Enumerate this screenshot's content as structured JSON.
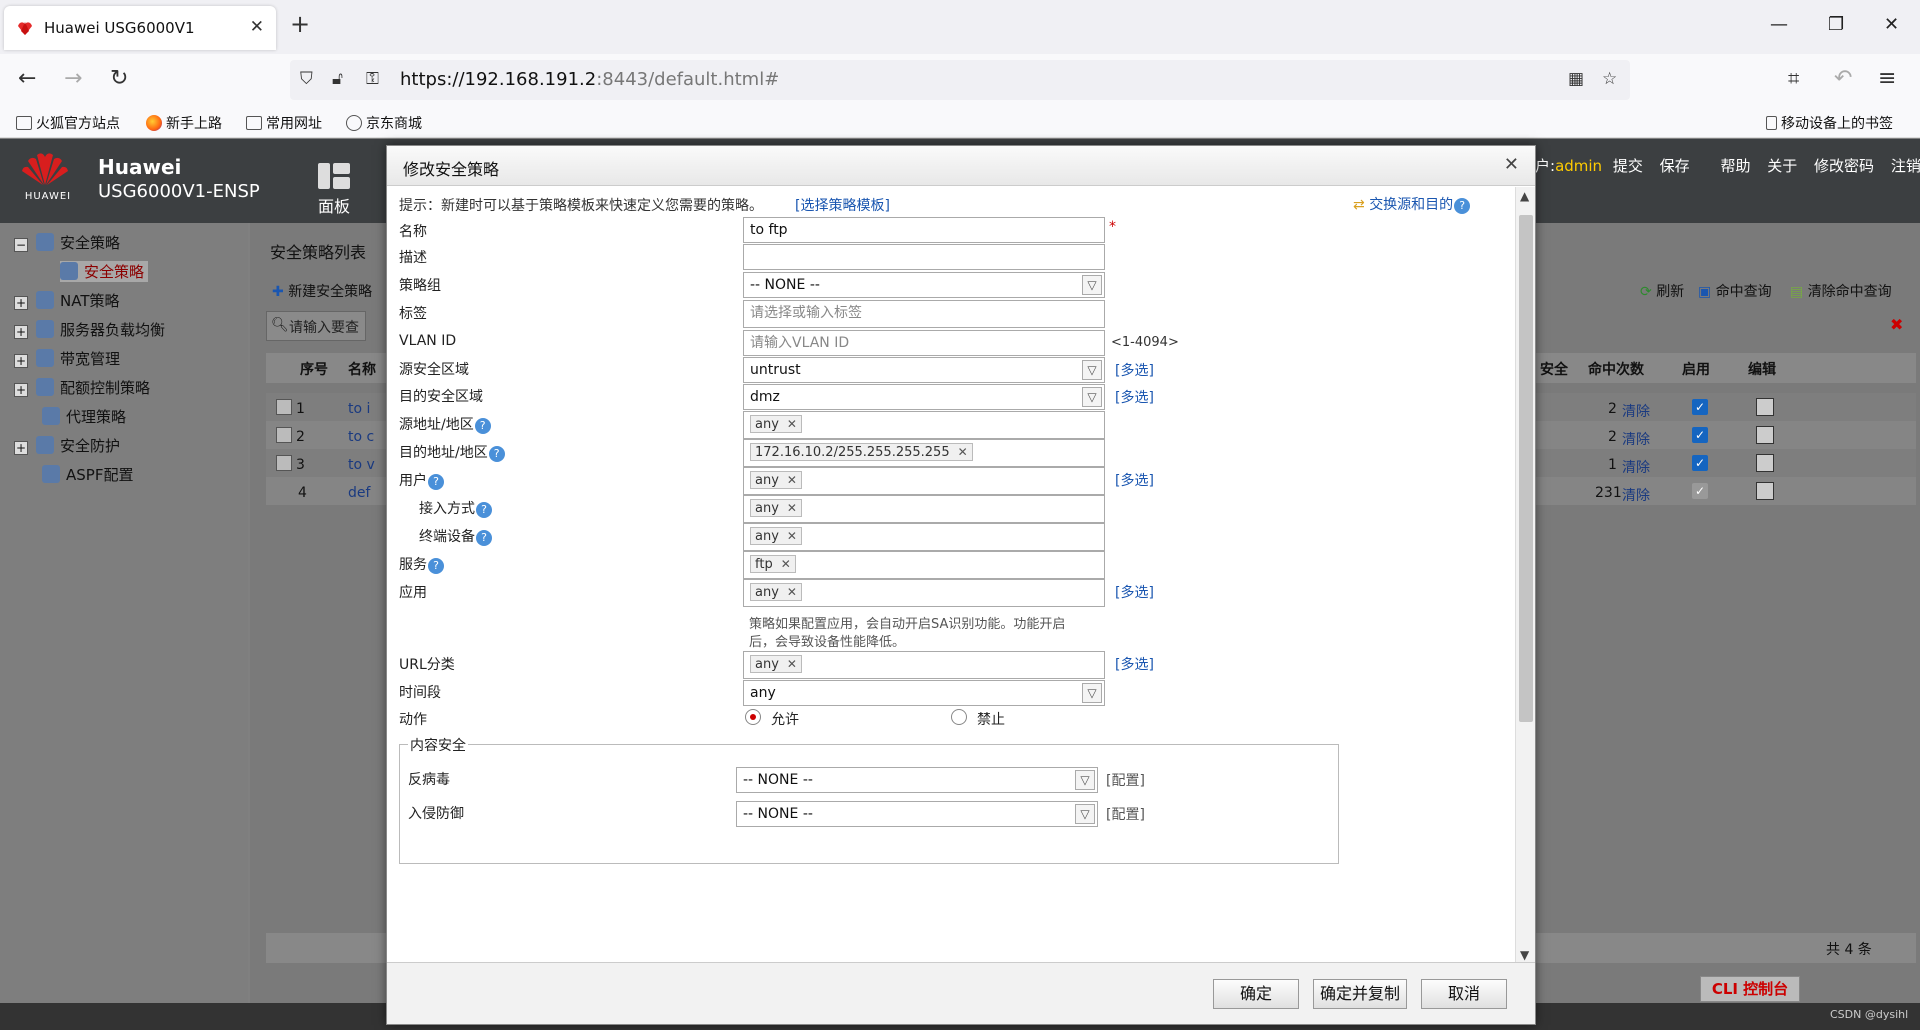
{
  "browser": {
    "tab_title": "Huawei USG6000V1",
    "url_host": "https://192.168.191.2",
    "url_rest": ":8443/default.html#",
    "bookmarks": [
      "火狐官方站点",
      "新手上路",
      "常用网址",
      "京东商城"
    ],
    "mobile_bookmarks": "移动设备上的书签"
  },
  "app": {
    "logo_text": "HUAWEI",
    "brand_name": "Huawei",
    "device_name": "USG6000V1-ENSP",
    "panel_label": "面板",
    "user_prefix": "户:",
    "user": "admin",
    "menu": [
      "提交",
      "保存",
      "帮助",
      "关于",
      "修改密码",
      "注销"
    ]
  },
  "sidebar": {
    "items": [
      {
        "label": "安全策略",
        "expand": "−"
      },
      {
        "label": "安全策略"
      },
      {
        "label": "NAT策略",
        "expand": "+"
      },
      {
        "label": "服务器负载均衡",
        "expand": "+"
      },
      {
        "label": "带宽管理",
        "expand": "+"
      },
      {
        "label": "配额控制策略",
        "expand": "+"
      },
      {
        "label": "代理策略"
      },
      {
        "label": "安全防护",
        "expand": "+"
      },
      {
        "label": "ASPF配置"
      }
    ]
  },
  "main": {
    "title": "安全策略列表",
    "new_button": "新建安全策略",
    "search_placeholder": "请输入要查",
    "refresh": "刷新",
    "hit_query": "命中查询",
    "clear_hit": "清除命中查询",
    "columns": {
      "index": "序号",
      "name": "名称",
      "security": "安全",
      "hits": "命中次数",
      "enable": "启用",
      "edit": "编辑"
    },
    "rows": [
      {
        "index": "1",
        "name": "to i",
        "hits": "2",
        "clear": "清除"
      },
      {
        "index": "2",
        "name": "to c",
        "hits": "2",
        "clear": "清除"
      },
      {
        "index": "3",
        "name": "to v",
        "hits": "1",
        "clear": "清除"
      },
      {
        "index": "4",
        "name": "def",
        "hits": "231",
        "clear": "清除"
      }
    ],
    "total": "共 4 条",
    "cli": "CLI 控制台",
    "watermark": "CSDN @dysihl"
  },
  "dialog": {
    "title": "修改安全策略",
    "hint_prefix": "提示：新建时可以基于策略模板来快速定义您需要的策略。",
    "hint_link": "[选择策略模板]",
    "swap": "交换源和目的",
    "fields": {
      "name_label": "名称",
      "name_value": "to ftp",
      "desc_label": "描述",
      "group_label": "策略组",
      "group_value": "-- NONE --",
      "tag_label": "标签",
      "tag_placeholder": "请选择或输入标签",
      "vlan_label": "VLAN ID",
      "vlan_placeholder": "请输入VLAN ID",
      "vlan_range": "<1-4094>",
      "src_zone_label": "源安全区域",
      "src_zone_value": "untrust",
      "dst_zone_label": "目的安全区域",
      "dst_zone_value": "dmz",
      "src_addr_label": "源地址/地区",
      "src_addr_value": "any",
      "dst_addr_label": "目的地址/地区",
      "dst_addr_value": "172.16.10.2/255.255.255.255",
      "user_label": "用户",
      "user_value": "any",
      "access_label": "接入方式",
      "access_value": "any",
      "terminal_label": "终端设备",
      "terminal_value": "any",
      "service_label": "服务",
      "service_value": "ftp",
      "app_label": "应用",
      "app_value": "any",
      "app_note_1": "策略如果配置应用，会自动开启SA识别功能。功能开启",
      "app_note_2": "后，会导致设备性能降低。",
      "url_label": "URL分类",
      "url_value": "any",
      "time_label": "时间段",
      "time_value": "any",
      "action_label": "动作",
      "allow": "允许",
      "deny": "禁止",
      "multi": "[多选]"
    },
    "content_security": {
      "legend": "内容安全",
      "antivirus_label": "反病毒",
      "antivirus_value": "-- NONE --",
      "ips_label": "入侵防御",
      "ips_value": "-- NONE --",
      "configure": "[配置]"
    },
    "buttons": {
      "ok": "确定",
      "ok_copy": "确定并复制",
      "cancel": "取消"
    }
  }
}
